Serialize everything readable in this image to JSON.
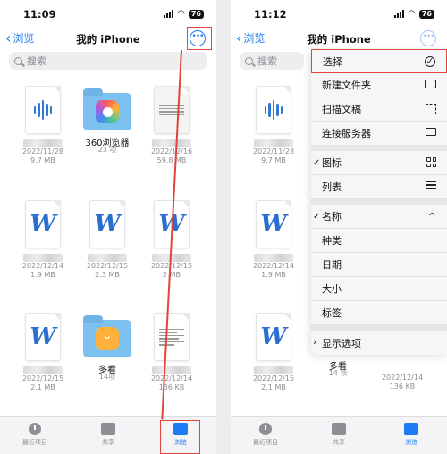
{
  "accent": "#1e7cf2",
  "annotation_color": "#e0443a",
  "left": {
    "status": {
      "time": "11:09",
      "battery": "76"
    },
    "nav": {
      "back_label": "浏览",
      "title": "我的 iPhone"
    },
    "search": {
      "placeholder": "搜索"
    },
    "files": [
      {
        "name": "",
        "date": "2022/11/28",
        "size": "9.7 MB"
      },
      {
        "name": "360浏览器",
        "date": "",
        "size": "23 项"
      },
      {
        "name": "",
        "date": "2022/12/16",
        "size": "59.8 MB"
      },
      {
        "name": "",
        "date": "2022/12/14",
        "size": "1.9 MB"
      },
      {
        "name": "",
        "date": "2022/12/15",
        "size": "2.3 MB"
      },
      {
        "name": "",
        "date": "2022/12/15",
        "size": "2 MB"
      },
      {
        "name": "",
        "date": "2022/12/15",
        "size": "2.1 MB"
      },
      {
        "name": "多看",
        "date": "",
        "size": "14项"
      },
      {
        "name": "",
        "date": "2022/12/14",
        "size": "136 KB"
      }
    ],
    "tabs": [
      {
        "label": "最近项目",
        "icon": "clock-icon"
      },
      {
        "label": "共享",
        "icon": "shared-folder-icon"
      },
      {
        "label": "浏览",
        "icon": "folder-icon"
      }
    ]
  },
  "right": {
    "status": {
      "time": "11:12",
      "battery": "76"
    },
    "nav": {
      "back_label": "浏览",
      "title": "我的 iPhone"
    },
    "search": {
      "placeholder": "搜索"
    },
    "files": [
      {
        "date": "2022/11/28",
        "size": "9.7 MB"
      },
      {
        "date": "2022/12/14",
        "size": "1.9 MB"
      },
      {
        "date": "2022/12/15",
        "size": "2.1 MB"
      },
      {
        "name": "多看",
        "size": "14 项"
      },
      {
        "date": "2022/12/14",
        "size": "136 KB"
      }
    ],
    "menu": {
      "select": "选择",
      "new_folder": "新建文件夹",
      "scan": "扫描文稿",
      "connect_server": "连接服务器",
      "view_icons": "图标",
      "view_list": "列表",
      "sort_name": "名称",
      "sort_kind": "种类",
      "sort_date": "日期",
      "sort_size": "大小",
      "sort_tags": "标签",
      "show_options": "显示选项"
    },
    "tabs": [
      {
        "label": "最近项目"
      },
      {
        "label": "共享"
      },
      {
        "label": "浏览"
      }
    ]
  }
}
